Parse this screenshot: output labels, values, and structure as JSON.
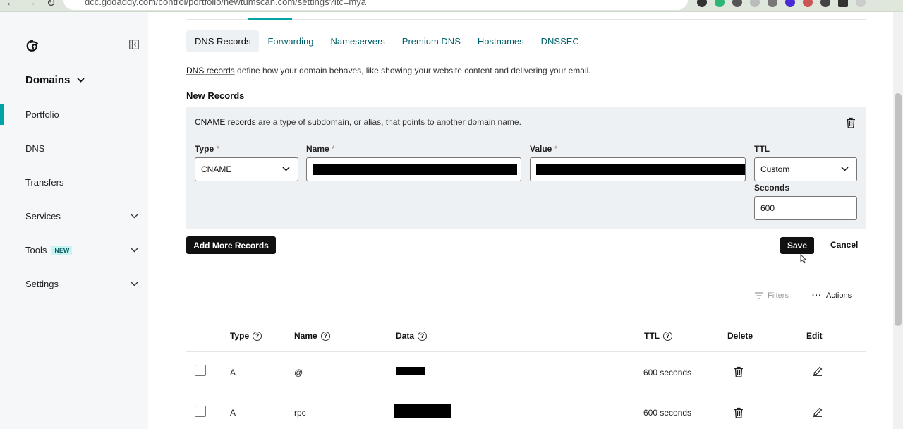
{
  "browser": {
    "url": "dcc.godaddy.com/control/portfolio/newtumscan.com/settings?itc=mya"
  },
  "sidebar": {
    "section": "Domains",
    "items": [
      {
        "label": "Portfolio"
      },
      {
        "label": "DNS"
      },
      {
        "label": "Transfers"
      },
      {
        "label": "Services"
      },
      {
        "label": "Tools",
        "badge": "NEW"
      },
      {
        "label": "Settings"
      }
    ]
  },
  "tabs": [
    "DNS Records",
    "Forwarding",
    "Nameservers",
    "Premium DNS",
    "Hostnames",
    "DNSSEC"
  ],
  "intro": {
    "link": "DNS records",
    "text": " define how your domain behaves, like showing your website content and delivering your email."
  },
  "new_records": {
    "title": "New Records",
    "desc_link": "CNAME records",
    "desc_text": " are a type of subdomain, or alias, that points to another domain name.",
    "type_label": "Type",
    "type_value": "CNAME",
    "name_label": "Name",
    "value_label": "Value",
    "required_mark": "*",
    "ttl_label": "TTL",
    "ttl_value": "Custom",
    "seconds_label": "Seconds",
    "seconds_value": "600"
  },
  "actions": {
    "add_more": "Add More Records",
    "save": "Save",
    "cancel": "Cancel",
    "filters": "Filters",
    "actions": "Actions"
  },
  "table": {
    "headers": {
      "type": "Type",
      "name": "Name",
      "data": "Data",
      "ttl": "TTL",
      "delete": "Delete",
      "edit": "Edit"
    },
    "help_glyph": "?",
    "rows": [
      {
        "type": "A",
        "name": "@",
        "ttl": "600 seconds"
      },
      {
        "type": "A",
        "name": "rpc",
        "ttl": "600 seconds"
      }
    ]
  },
  "colors": {
    "accent": "#00a4a6",
    "link": "#00616a",
    "dark_button": "#111111"
  }
}
